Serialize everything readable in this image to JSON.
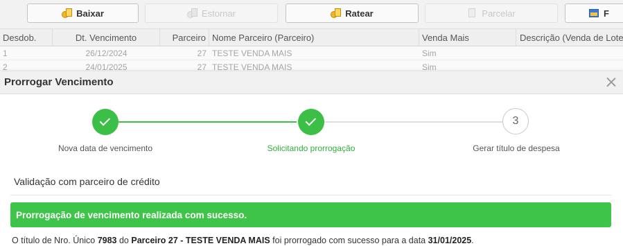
{
  "toolbar": {
    "buttons": [
      {
        "label": "Baixar",
        "icon": "money-icon",
        "enabled": true
      },
      {
        "label": "Estornar",
        "icon": "money-icon",
        "enabled": false
      },
      {
        "label": "Ratear",
        "icon": "money-icon",
        "enabled": true
      },
      {
        "label": "Parcelar",
        "icon": "document-icon",
        "enabled": false
      },
      {
        "label": "F",
        "icon": "table-icon",
        "enabled": true
      }
    ]
  },
  "grid": {
    "columns": [
      "Desdob.",
      "Dt. Vencimento",
      "Parceiro",
      "Nome Parceiro (Parceiro)",
      "Venda Mais",
      "Descrição (Venda de Lote)"
    ],
    "rows": [
      [
        "1",
        "26/12/2024",
        "27",
        "TESTE VENDA MAIS",
        "Sim",
        ""
      ],
      [
        "2",
        "24/01/2025",
        "27",
        "TESTE VENDA MAIS",
        "Sim",
        ""
      ]
    ]
  },
  "modal": {
    "title": "Prorrogar Vencimento",
    "steps": [
      {
        "label": "Nova data de vencimento",
        "status": "done",
        "number": ""
      },
      {
        "label": "Solicitando prorrogação",
        "status": "done",
        "number": ""
      },
      {
        "label": "Gerar título de despesa",
        "status": "pending",
        "number": "3"
      }
    ],
    "section_title": "Validação com parceiro de crédito",
    "success_message": "Prorrogação de vencimento realizada com sucesso.",
    "result": {
      "prefix": "O título de Nro. Único",
      "nro_unico": "7983",
      "middle": "do",
      "partner": "Parceiro 27 - TESTE VENDA MAIS",
      "suffix": "foi prorrogado com sucesso para a data",
      "date": "31/01/2025",
      "end": "."
    }
  },
  "colors": {
    "success": "#3ec448",
    "step_done": "#3cbf46",
    "step_label_active": "#2fae3a",
    "step_pending_border": "#c9c9c9"
  }
}
